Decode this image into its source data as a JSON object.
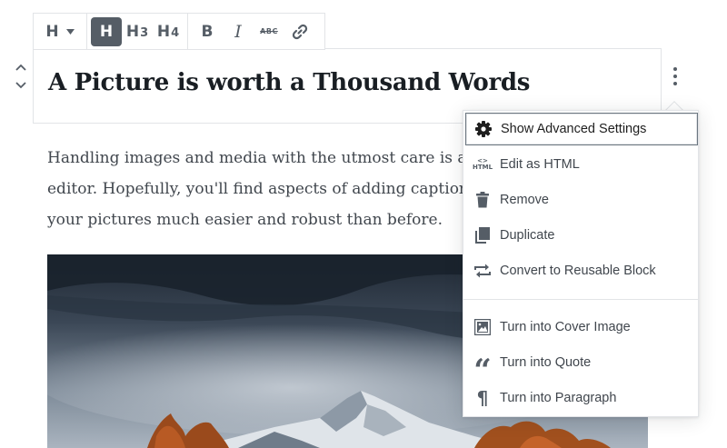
{
  "toolbar": {
    "heading_switcher": "H",
    "levels": [
      {
        "main": "H",
        "sub": "",
        "active": true
      },
      {
        "main": "H",
        "sub": "3",
        "active": false
      },
      {
        "main": "H",
        "sub": "4",
        "active": false
      }
    ],
    "bold_label": "B",
    "italic_label": "I",
    "strike_label": "ABC"
  },
  "heading": {
    "text": "A Picture is worth a Thousand Words"
  },
  "paragraph": {
    "lines": [
      "Handling images and media with the utmost care is a p",
      "editor. Hopefully, you'll find aspects of adding captions",
      "your pictures much easier and robust than before."
    ]
  },
  "menu": {
    "html_icon_top": "<>",
    "html_icon_bottom": "HTML",
    "quote_icon": "“",
    "paragraph_icon": "¶",
    "items": [
      {
        "label": "Show Advanced Settings",
        "icon": "gear-icon"
      },
      {
        "label": "Edit as HTML",
        "icon": "html-icon"
      },
      {
        "label": "Remove",
        "icon": "trash-icon"
      },
      {
        "label": "Duplicate",
        "icon": "duplicate-icon"
      },
      {
        "label": "Convert to Reusable Block",
        "icon": "convert-icon"
      },
      {
        "label": "Turn into Cover Image",
        "icon": "cover-image-icon"
      },
      {
        "label": "Turn into Quote",
        "icon": "quote-icon"
      },
      {
        "label": "Turn into Paragraph",
        "icon": "paragraph-icon"
      }
    ]
  },
  "colors": {
    "ui_gray": "#555d66",
    "border": "#e2e4e7",
    "heading_text": "#191e23",
    "body_text": "#40464d"
  }
}
